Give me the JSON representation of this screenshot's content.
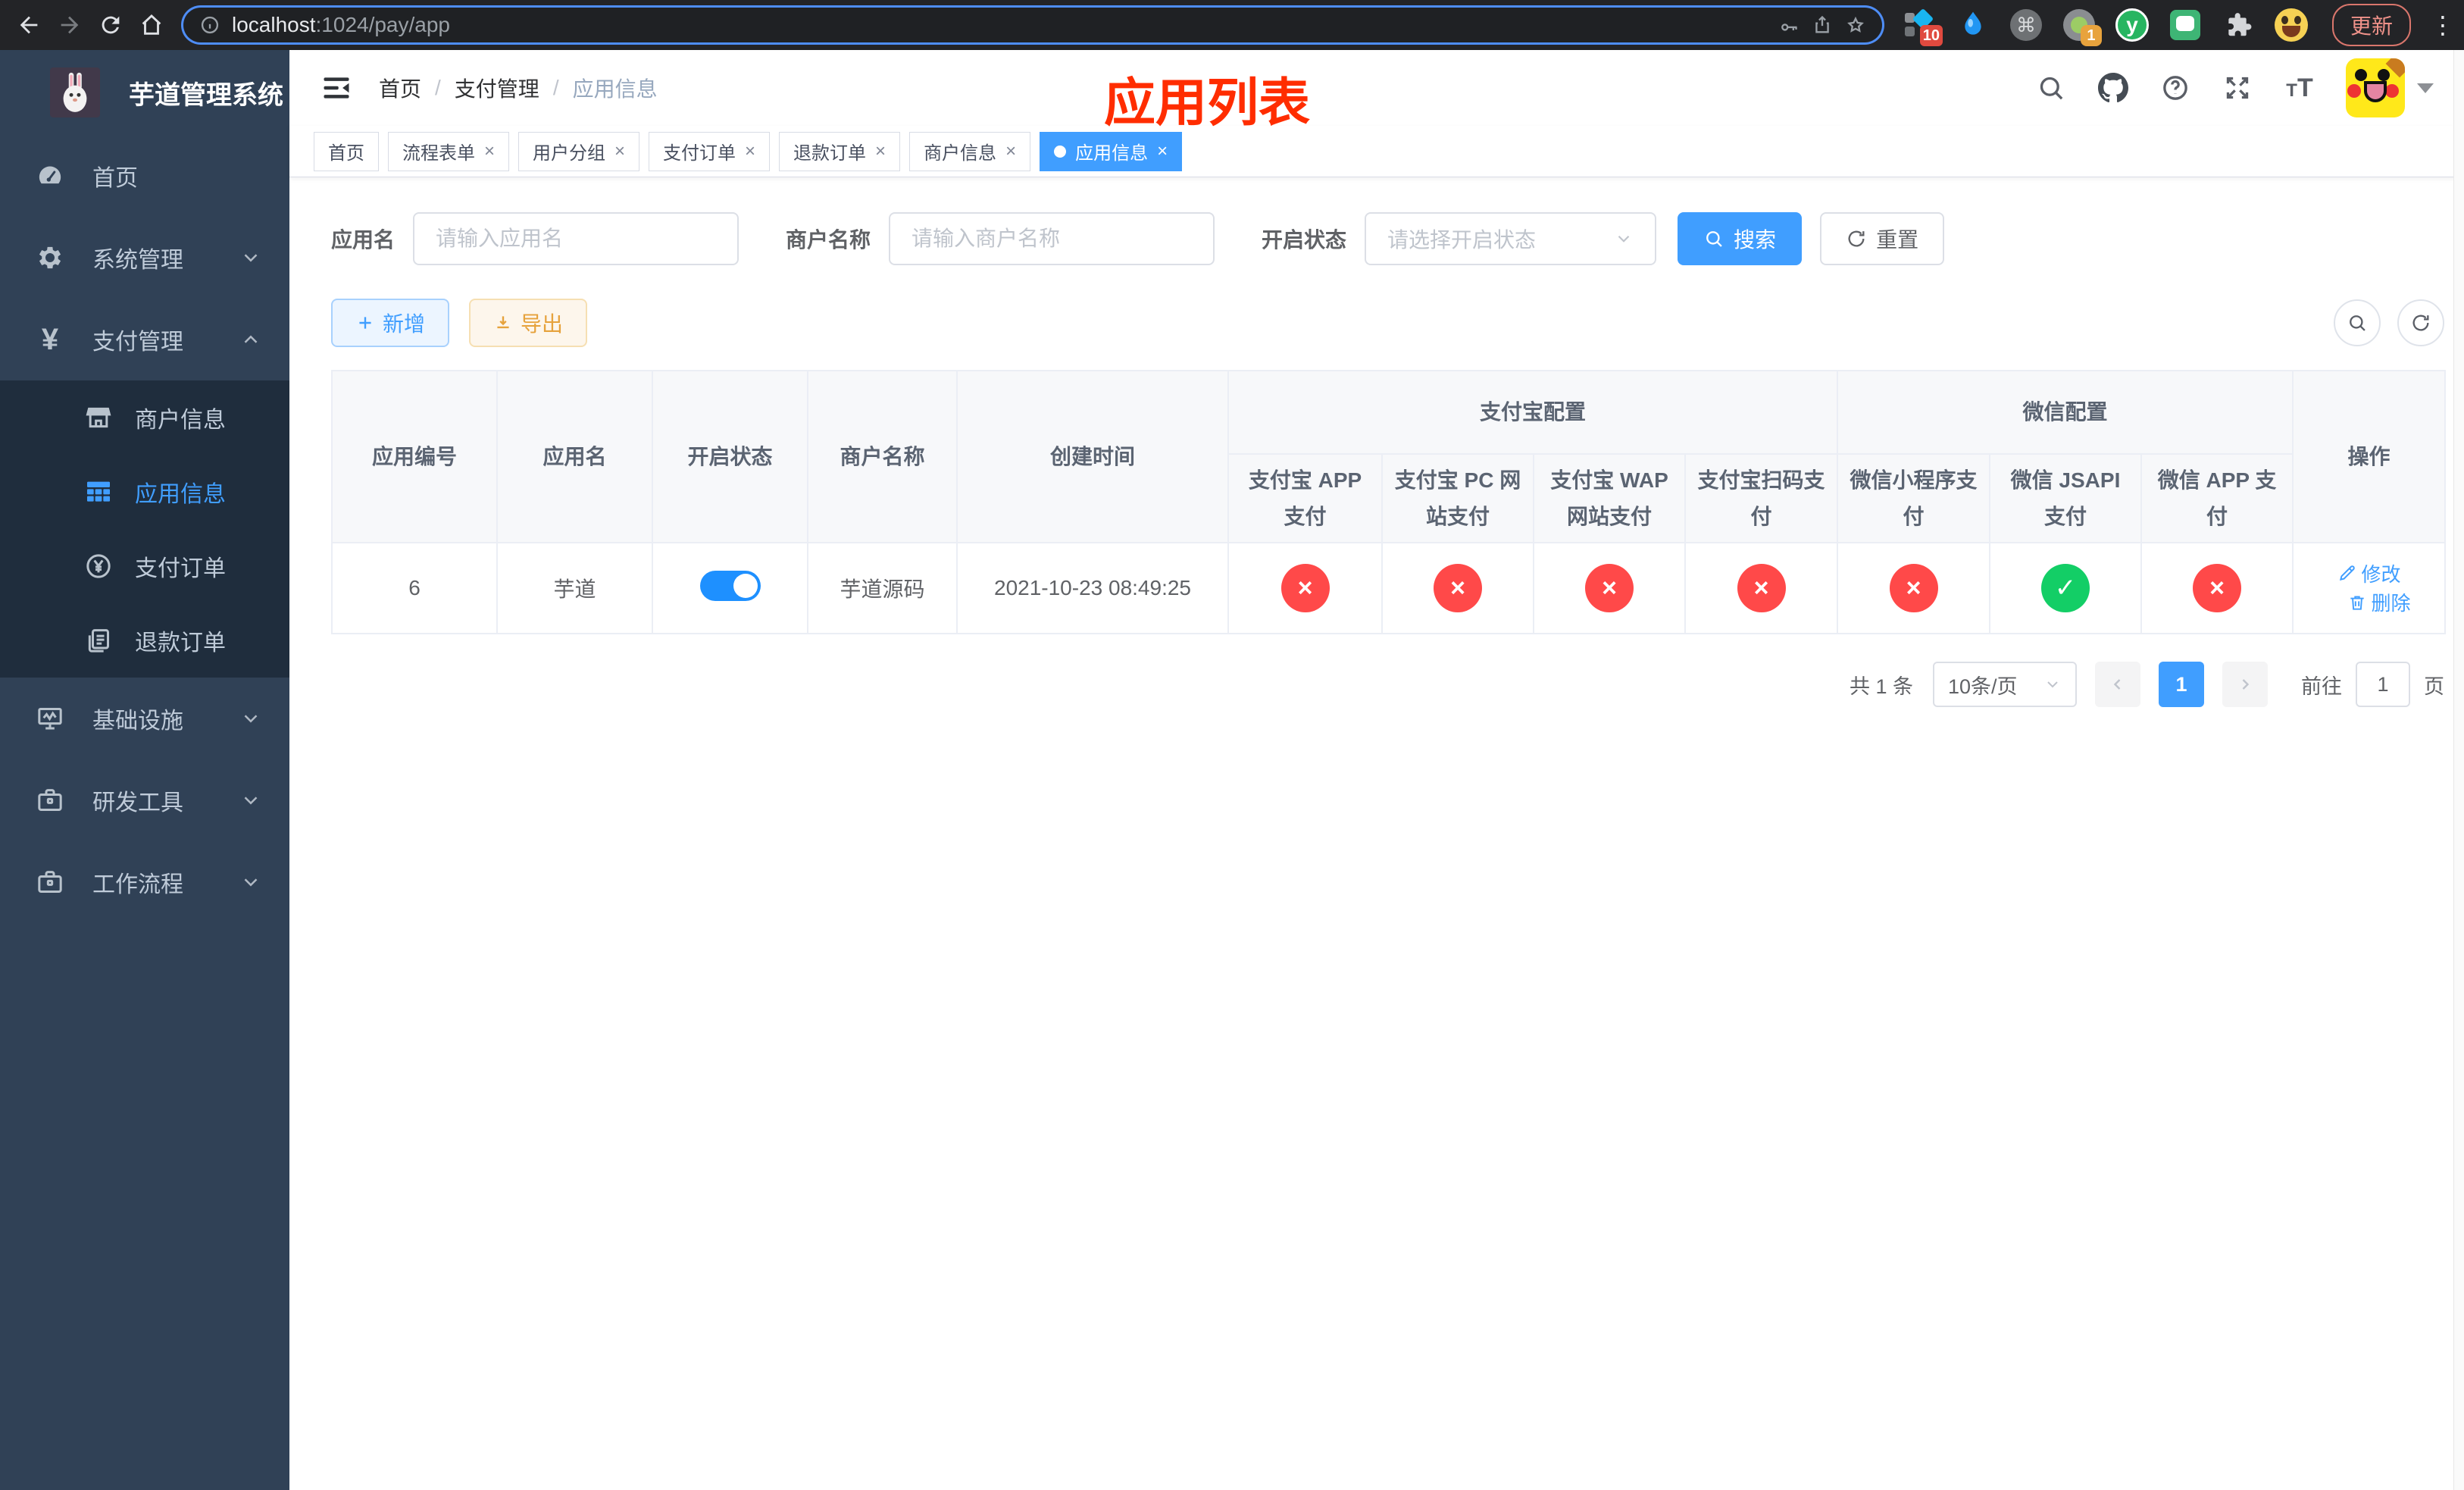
{
  "browser": {
    "url_host": "localhost",
    "url_rest": ":1024/pay/app",
    "ext_badge_a": "10",
    "ext_badge_b": "1",
    "update_label": "更新"
  },
  "sidebar": {
    "title": "芋道管理系统",
    "items_top": [
      "首页",
      "系统管理",
      "支付管理"
    ],
    "submenu": [
      "商户信息",
      "应用信息",
      "支付订单",
      "退款订单"
    ],
    "active_submenu": "应用信息",
    "items_bottom": [
      "基础设施",
      "研发工具",
      "工作流程"
    ]
  },
  "header": {
    "breadcrumb": [
      "首页",
      "支付管理",
      "应用信息"
    ],
    "annotation": "应用列表"
  },
  "tabs": {
    "items": [
      "首页",
      "流程表单",
      "用户分组",
      "支付订单",
      "退款订单",
      "商户信息",
      "应用信息"
    ],
    "active": "应用信息"
  },
  "filters": {
    "app_name_label": "应用名",
    "app_name_placeholder": "请输入应用名",
    "merchant_label": "商户名称",
    "merchant_placeholder": "请输入商户名称",
    "status_label": "开启状态",
    "status_placeholder": "请选择开启状态",
    "search_label": "搜索",
    "reset_label": "重置"
  },
  "toolbar": {
    "add_label": "新增",
    "export_label": "导出"
  },
  "table": {
    "main_columns": [
      "应用编号",
      "应用名",
      "开启状态",
      "商户名称",
      "创建时间"
    ],
    "group_columns": [
      "支付宝配置",
      "微信配置"
    ],
    "sub_columns": [
      "支付宝 APP 支付",
      "支付宝 PC 网站支付",
      "支付宝 WAP 网站支付",
      "支付宝扫码支付",
      "微信小程序支付",
      "微信 JSAPI 支付",
      "微信 APP 支付"
    ],
    "actions_column": "操作",
    "row": {
      "id": "6",
      "name": "芋道",
      "enabled": true,
      "merchant": "芋道源码",
      "created_at": "2021-10-23 08:49:25",
      "statuses": [
        false,
        false,
        false,
        false,
        false,
        true,
        false
      ],
      "edit_label": "修改",
      "delete_label": "删除"
    }
  },
  "pagination": {
    "total": "共 1 条",
    "per_page": "10条/页",
    "page": "1",
    "goto_label": "前往",
    "goto_value": "1",
    "page_unit": "页"
  },
  "colors": {
    "accent": "#409EFF",
    "success": "#13CE66",
    "danger": "#FF4949",
    "annotation_red": "#FF2D00",
    "sidebar_bg": "#304156",
    "submenu_bg": "#1F2D3D"
  }
}
